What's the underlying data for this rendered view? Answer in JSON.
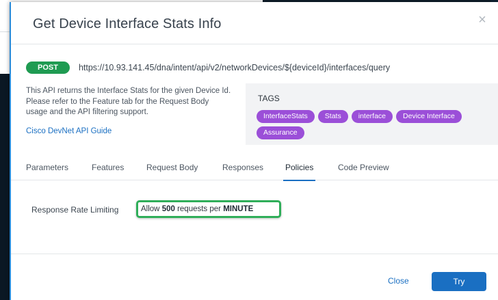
{
  "modal": {
    "title": "Get Device Interface Stats Info",
    "close_icon": "×"
  },
  "endpoint": {
    "method": "POST",
    "url": "https://10.93.141.45/dna/intent/api/v2/networkDevices/${deviceId}/interfaces/query"
  },
  "description": {
    "text": "This API returns the Interface Stats for the given Device Id. Please refer to the Feature tab for the Request Body usage and the API filtering support.",
    "guide_link": "Cisco DevNet API Guide"
  },
  "tags": {
    "title": "TAGS",
    "items": [
      "InterfaceStats",
      "Stats",
      "interface",
      "Device Interface",
      "Assurance"
    ]
  },
  "tabs": [
    {
      "label": "Parameters"
    },
    {
      "label": "Features"
    },
    {
      "label": "Request Body"
    },
    {
      "label": "Responses"
    },
    {
      "label": "Policies"
    },
    {
      "label": "Code Preview"
    }
  ],
  "active_tab": "Policies",
  "policy": {
    "label": "Response Rate Limiting",
    "prefix": "Allow",
    "count": "500",
    "middle": "requests per",
    "unit": "MINUTE"
  },
  "footer": {
    "close_label": "Close",
    "try_label": "Try"
  },
  "colors": {
    "accent": "#1a6fc2",
    "post_badge": "#1f9b52",
    "tag": "#9b4fd8",
    "highlight": "#2fae59"
  }
}
